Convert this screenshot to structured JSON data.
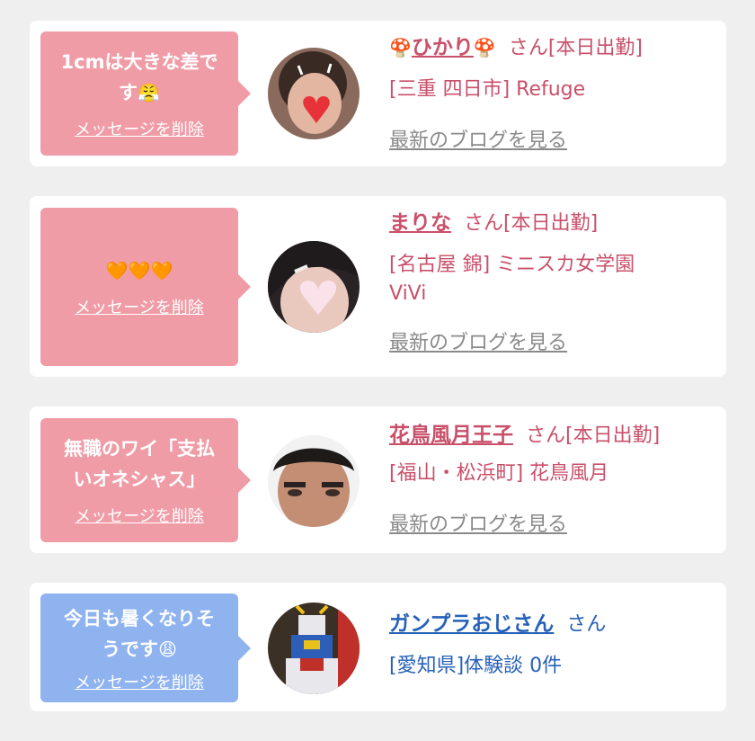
{
  "colors": {
    "pink_bubble": "#f09ca6",
    "blue_bubble": "#8fb3ef",
    "pink_text": "#c9506a",
    "blue_text": "#2761b8",
    "blog_link": "#8a8a8a"
  },
  "cards": [
    {
      "message_line1": "1cmは大きな差で",
      "message_line2": "す",
      "message_emoji": "😤",
      "delete_label": "メッセージを削除",
      "name_prefix_icon": "🍄",
      "name": "ひかり",
      "name_suffix_icon": "🍄",
      "honorific": "さん",
      "status": "[本日出勤]",
      "shop": "[三重 四日市] Refuge",
      "blog_link": "最新のブログを見る"
    },
    {
      "message_emoji": "🧡🧡🧡",
      "delete_label": "メッセージを削除",
      "name": "まりな",
      "honorific": "さん",
      "status": "[本日出勤]",
      "shop_line1": "[名古屋 錦] ミニスカ女学園",
      "shop_line2": "ViVi",
      "blog_link": "最新のブログを見る"
    },
    {
      "message_line1": "無職のワイ「支払",
      "message_line2": "いオネシャス」",
      "delete_label": "メッセージを削除",
      "name": "花鳥風月王子",
      "honorific": "さん",
      "status": "[本日出勤]",
      "shop": "[福山・松浜町] 花鳥風月",
      "blog_link": "最新のブログを見る"
    },
    {
      "message_line1": "今日も暑くなりそ",
      "message_line2": "うです",
      "message_emoji": "😩",
      "delete_label": "メッセージを削除",
      "name": "ガンプラおじさん",
      "honorific": "さん",
      "info": "[愛知県]体験談 0件"
    }
  ]
}
